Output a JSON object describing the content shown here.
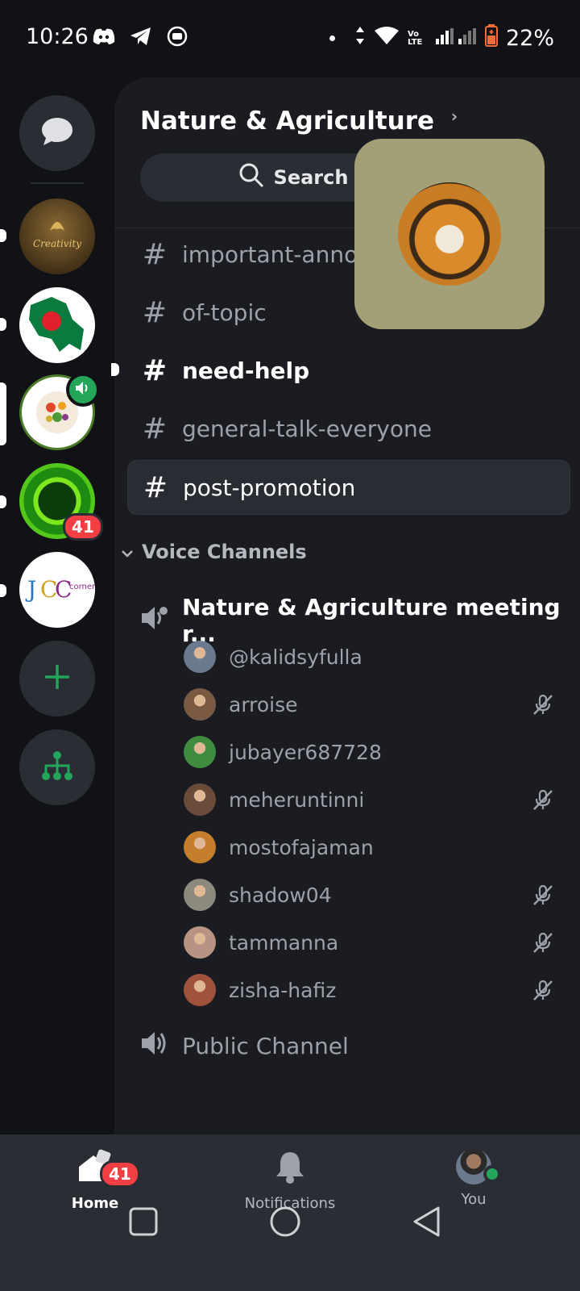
{
  "status_bar": {
    "time": "10:26",
    "battery": "22%",
    "volte": "Vo LTE"
  },
  "server_title": "Nature & Agriculture",
  "search": {
    "label": "Search"
  },
  "servers": [
    {
      "name": "messages",
      "badge": ""
    },
    {
      "name": "creativity",
      "badge": ""
    },
    {
      "name": "bangladesh-map",
      "badge": ""
    },
    {
      "name": "nature-agriculture",
      "badge": ""
    },
    {
      "name": "green-circle",
      "badge": "41"
    },
    {
      "name": "jcc-corner",
      "badge": ""
    }
  ],
  "channels": [
    {
      "name": "important-anno",
      "state": "normal"
    },
    {
      "name": "of-topic",
      "state": "normal"
    },
    {
      "name": "need-help",
      "state": "unread"
    },
    {
      "name": "general-talk-everyone",
      "state": "normal"
    },
    {
      "name": "post-promotion",
      "state": "selected"
    }
  ],
  "voice_category": "Voice Channels",
  "voice_channel": {
    "name": "Nature & Agriculture meeting r..."
  },
  "members": [
    {
      "name": "@kalidsyfulla",
      "muted": false,
      "color": "#6b7a8f"
    },
    {
      "name": "arroise",
      "muted": true,
      "color": "#7a5a43"
    },
    {
      "name": "jubayer687728",
      "muted": false,
      "color": "#3f8b3f"
    },
    {
      "name": "meheruntinni",
      "muted": true,
      "color": "#6a4b3a"
    },
    {
      "name": "mostofajaman",
      "muted": false,
      "color": "#c57e2c"
    },
    {
      "name": "shadow04",
      "muted": true,
      "color": "#8c8a7c"
    },
    {
      "name": "tammanna",
      "muted": true,
      "color": "#b89383"
    },
    {
      "name": "zisha-hafiz",
      "muted": true,
      "color": "#a0523c"
    }
  ],
  "public_channel": "Public Channel",
  "bottom_nav": {
    "home": "Home",
    "home_badge": "41",
    "notifications": "Notifications",
    "you": "You"
  },
  "colors": {
    "accent_green": "#23a55a",
    "badge_red": "#f23f43"
  }
}
